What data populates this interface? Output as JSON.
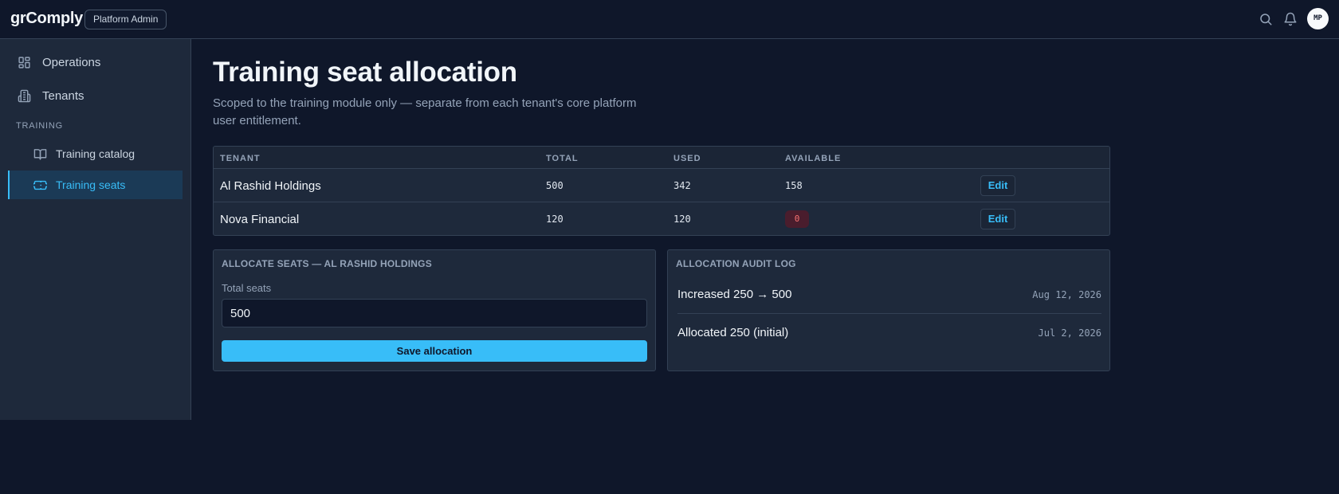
{
  "app": {
    "brand": "grComply",
    "role_badge": "Platform Admin",
    "avatar_initials": "MP"
  },
  "sidebar": {
    "items": [
      {
        "label": "Operations",
        "icon": "grid-icon"
      },
      {
        "label": "Tenants",
        "icon": "building-icon"
      }
    ],
    "section_label": "TRAINING",
    "sub_items": [
      {
        "label": "Training catalog",
        "icon": "book-icon",
        "active": false
      },
      {
        "label": "Training seats",
        "icon": "ticket-icon",
        "active": true
      }
    ]
  },
  "page": {
    "title": "Training seat allocation",
    "subtitle": "Scoped to the training module only — separate from each tenant's core platform user entitlement."
  },
  "table": {
    "headers": [
      "TENANT",
      "TOTAL",
      "USED",
      "AVAILABLE"
    ],
    "rows": [
      {
        "tenant": "Al Rashid Holdings",
        "total": "500",
        "used": "342",
        "available": "158",
        "action": "Edit"
      },
      {
        "tenant": "Nova Financial",
        "total": "120",
        "used": "120",
        "available": "0",
        "action": "Edit"
      }
    ]
  },
  "allocate": {
    "title": "ALLOCATE SEATS — AL RASHID HOLDINGS",
    "field_label": "Total seats",
    "value": "500",
    "button": "Save allocation"
  },
  "audit": {
    "title": "ALLOCATION AUDIT LOG",
    "entries": [
      {
        "text": "Increased 250 → 500",
        "date": "Aug 12, 2026"
      },
      {
        "text": "Allocated 250 (initial)",
        "date": "Jul 2, 2026"
      }
    ]
  },
  "colors": {
    "background": "#0f172a",
    "panel": "#1e293b",
    "accent": "#38bdf8",
    "danger": "#f87171"
  }
}
